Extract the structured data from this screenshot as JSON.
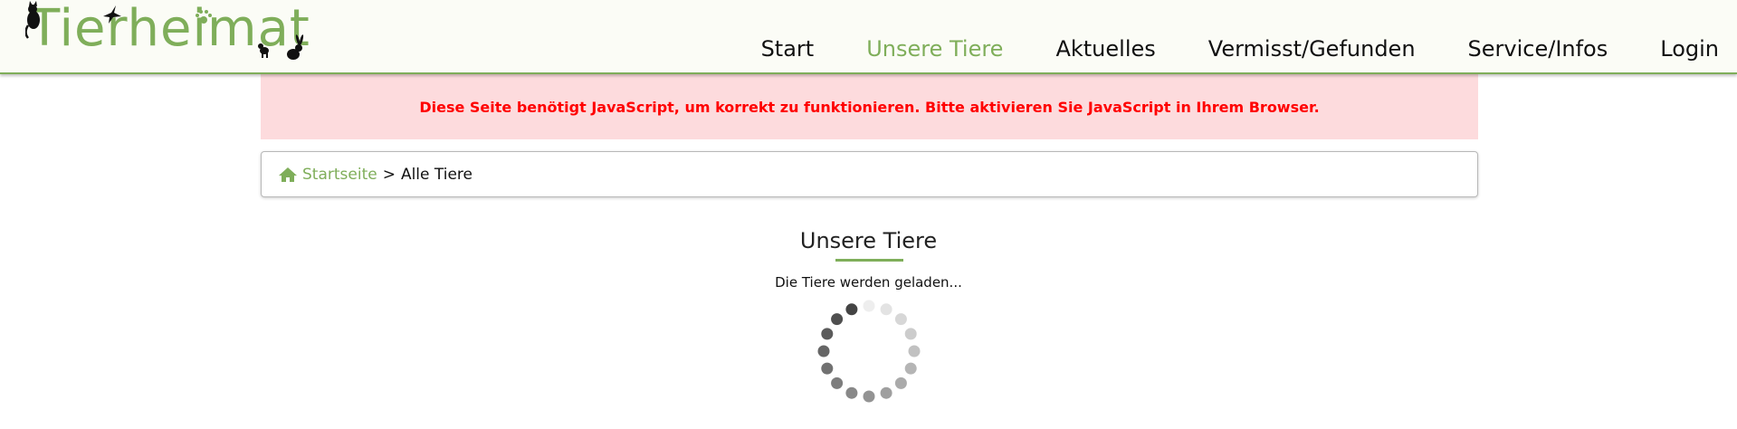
{
  "header": {
    "logo_text": "Tierheimat",
    "nav": [
      {
        "label": "Start",
        "active": false
      },
      {
        "label": "Unsere Tiere",
        "active": true
      },
      {
        "label": "Aktuelles",
        "active": false
      },
      {
        "label": "Vermisst/Gefunden",
        "active": false
      },
      {
        "label": "Service/Infos",
        "active": false
      },
      {
        "label": "Login",
        "active": false
      }
    ]
  },
  "alert": {
    "message": "Diese Seite benötigt JavaScript, um korrekt zu funktionieren. Bitte aktivieren Sie JavaScript in Ihrem Browser."
  },
  "breadcrumb": {
    "home_label": "Startseite",
    "separator": ">",
    "current": "Alle Tiere"
  },
  "main": {
    "title": "Unsere Tiere",
    "loading_text": "Die Tiere werden geladen..."
  },
  "colors": {
    "brand_green": "#7fae5a",
    "alert_background": "#fddbdd",
    "alert_text": "#ff0000"
  },
  "icons": [
    "cat-icon",
    "bird-icon",
    "paw-icon",
    "dog-icon",
    "rabbit-icon",
    "home-icon",
    "loading-spinner-icon"
  ]
}
